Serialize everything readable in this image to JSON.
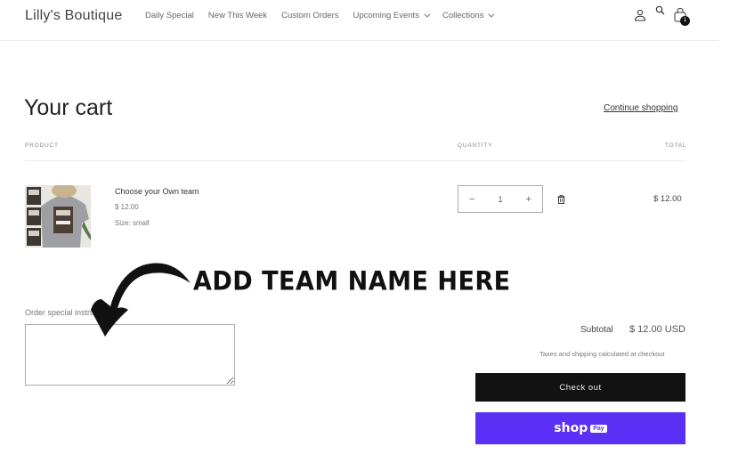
{
  "header": {
    "logo": "Lilly's Boutique",
    "nav": [
      {
        "label": "Daily Special",
        "has_dropdown": false
      },
      {
        "label": "New This Week",
        "has_dropdown": false
      },
      {
        "label": "Custom Orders",
        "has_dropdown": false
      },
      {
        "label": "Upcoming Events",
        "has_dropdown": true
      },
      {
        "label": "Collections",
        "has_dropdown": true
      }
    ],
    "icons": [
      "account-icon",
      "search-icon",
      "cart-icon"
    ],
    "cart_count": "1"
  },
  "cart": {
    "title": "Your cart",
    "continue_shopping": "Continue shopping",
    "columns": {
      "product": "PRODUCT",
      "quantity": "QUANTITY",
      "total": "TOTAL"
    },
    "items": [
      {
        "name": "Choose your Own team",
        "price": "$ 12.00",
        "size": "Size: small",
        "quantity": "1",
        "decrement": "−",
        "increment": "+",
        "line_total": "$ 12.00"
      }
    ]
  },
  "annotation": {
    "text": "ADD TEAM NAME HERE"
  },
  "notes": {
    "label": "Order special instructions",
    "value": ""
  },
  "summary": {
    "subtotal_label": "Subtotal",
    "subtotal_value": "$ 12.00 USD",
    "tax_note": "Taxes and shipping calculated at checkout",
    "checkout_label": "Check out",
    "shoppay_word": "shop",
    "shoppay_pill": "Pay"
  },
  "colors": {
    "checkout_bg": "#121212",
    "shoppay_bg": "#5a31f4"
  }
}
